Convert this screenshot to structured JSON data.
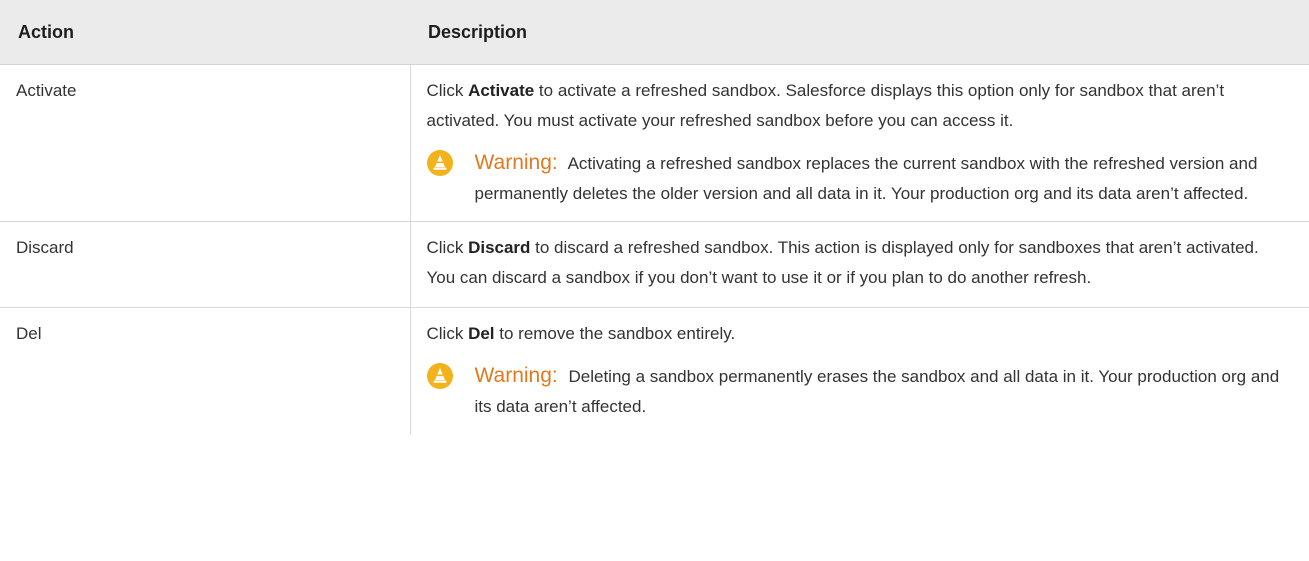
{
  "table": {
    "headers": {
      "action": "Action",
      "description": "Description"
    },
    "rows": [
      {
        "action": "Activate",
        "description": {
          "prefix": "Click ",
          "bold": "Activate",
          "suffix": " to activate a refreshed sandbox. Salesforce displays this option only for sandbox that aren’t activated. You must activate your refreshed sandbox before you can access it."
        },
        "warning": {
          "label": "Warning:",
          "text": "Activating a refreshed sandbox replaces the current sandbox with the refreshed version and permanently deletes the older version and all data in it. Your production org and its data aren’t affected."
        }
      },
      {
        "action": "Discard",
        "description": {
          "prefix": "Click ",
          "bold": "Discard",
          "suffix": " to discard a refreshed sandbox. This action is displayed only for sandboxes that aren’t activated. You can discard a sandbox if you don’t want to use it or if you plan to do another refresh."
        }
      },
      {
        "action": "Del",
        "description": {
          "prefix": "Click ",
          "bold": "Del",
          "suffix": " to remove the sandbox entirely."
        },
        "warning": {
          "label": "Warning:",
          "text": "Deleting a sandbox permanently erases the sandbox and all data in it. Your production org and its data aren’t affected."
        }
      }
    ]
  },
  "icons": {
    "warning": "warning-cone-icon"
  },
  "colors": {
    "header_bg": "#ebebeb",
    "warning_label": "#e07a1f",
    "warning_icon": "#f2b21b",
    "border": "#d8d8d8"
  }
}
